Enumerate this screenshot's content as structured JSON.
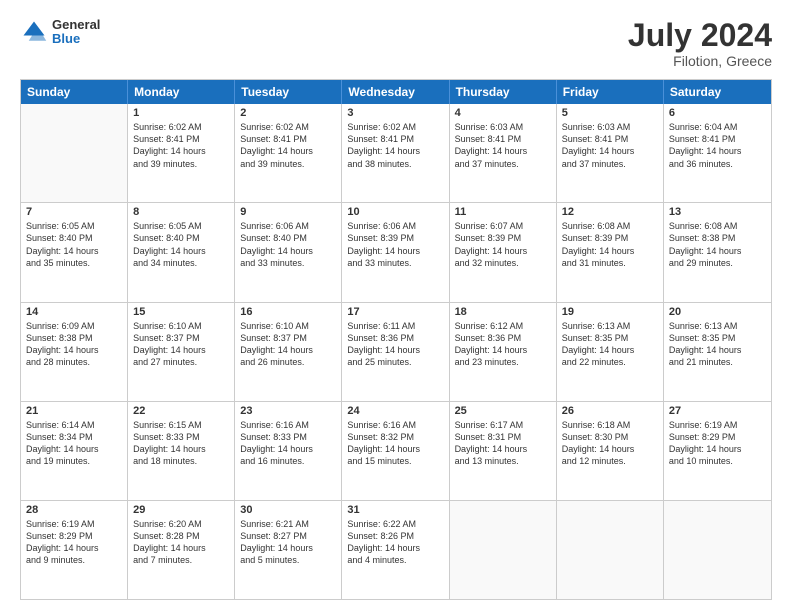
{
  "header": {
    "logo": {
      "general": "General",
      "blue": "Blue"
    },
    "title": "July 2024",
    "location": "Filotion, Greece"
  },
  "weekdays": [
    "Sunday",
    "Monday",
    "Tuesday",
    "Wednesday",
    "Thursday",
    "Friday",
    "Saturday"
  ],
  "weeks": [
    [
      {
        "day": "",
        "info": ""
      },
      {
        "day": "1",
        "info": "Sunrise: 6:02 AM\nSunset: 8:41 PM\nDaylight: 14 hours\nand 39 minutes."
      },
      {
        "day": "2",
        "info": "Sunrise: 6:02 AM\nSunset: 8:41 PM\nDaylight: 14 hours\nand 39 minutes."
      },
      {
        "day": "3",
        "info": "Sunrise: 6:02 AM\nSunset: 8:41 PM\nDaylight: 14 hours\nand 38 minutes."
      },
      {
        "day": "4",
        "info": "Sunrise: 6:03 AM\nSunset: 8:41 PM\nDaylight: 14 hours\nand 37 minutes."
      },
      {
        "day": "5",
        "info": "Sunrise: 6:03 AM\nSunset: 8:41 PM\nDaylight: 14 hours\nand 37 minutes."
      },
      {
        "day": "6",
        "info": "Sunrise: 6:04 AM\nSunset: 8:41 PM\nDaylight: 14 hours\nand 36 minutes."
      }
    ],
    [
      {
        "day": "7",
        "info": "Sunrise: 6:05 AM\nSunset: 8:40 PM\nDaylight: 14 hours\nand 35 minutes."
      },
      {
        "day": "8",
        "info": "Sunrise: 6:05 AM\nSunset: 8:40 PM\nDaylight: 14 hours\nand 34 minutes."
      },
      {
        "day": "9",
        "info": "Sunrise: 6:06 AM\nSunset: 8:40 PM\nDaylight: 14 hours\nand 33 minutes."
      },
      {
        "day": "10",
        "info": "Sunrise: 6:06 AM\nSunset: 8:39 PM\nDaylight: 14 hours\nand 33 minutes."
      },
      {
        "day": "11",
        "info": "Sunrise: 6:07 AM\nSunset: 8:39 PM\nDaylight: 14 hours\nand 32 minutes."
      },
      {
        "day": "12",
        "info": "Sunrise: 6:08 AM\nSunset: 8:39 PM\nDaylight: 14 hours\nand 31 minutes."
      },
      {
        "day": "13",
        "info": "Sunrise: 6:08 AM\nSunset: 8:38 PM\nDaylight: 14 hours\nand 29 minutes."
      }
    ],
    [
      {
        "day": "14",
        "info": "Sunrise: 6:09 AM\nSunset: 8:38 PM\nDaylight: 14 hours\nand 28 minutes."
      },
      {
        "day": "15",
        "info": "Sunrise: 6:10 AM\nSunset: 8:37 PM\nDaylight: 14 hours\nand 27 minutes."
      },
      {
        "day": "16",
        "info": "Sunrise: 6:10 AM\nSunset: 8:37 PM\nDaylight: 14 hours\nand 26 minutes."
      },
      {
        "day": "17",
        "info": "Sunrise: 6:11 AM\nSunset: 8:36 PM\nDaylight: 14 hours\nand 25 minutes."
      },
      {
        "day": "18",
        "info": "Sunrise: 6:12 AM\nSunset: 8:36 PM\nDaylight: 14 hours\nand 23 minutes."
      },
      {
        "day": "19",
        "info": "Sunrise: 6:13 AM\nSunset: 8:35 PM\nDaylight: 14 hours\nand 22 minutes."
      },
      {
        "day": "20",
        "info": "Sunrise: 6:13 AM\nSunset: 8:35 PM\nDaylight: 14 hours\nand 21 minutes."
      }
    ],
    [
      {
        "day": "21",
        "info": "Sunrise: 6:14 AM\nSunset: 8:34 PM\nDaylight: 14 hours\nand 19 minutes."
      },
      {
        "day": "22",
        "info": "Sunrise: 6:15 AM\nSunset: 8:33 PM\nDaylight: 14 hours\nand 18 minutes."
      },
      {
        "day": "23",
        "info": "Sunrise: 6:16 AM\nSunset: 8:33 PM\nDaylight: 14 hours\nand 16 minutes."
      },
      {
        "day": "24",
        "info": "Sunrise: 6:16 AM\nSunset: 8:32 PM\nDaylight: 14 hours\nand 15 minutes."
      },
      {
        "day": "25",
        "info": "Sunrise: 6:17 AM\nSunset: 8:31 PM\nDaylight: 14 hours\nand 13 minutes."
      },
      {
        "day": "26",
        "info": "Sunrise: 6:18 AM\nSunset: 8:30 PM\nDaylight: 14 hours\nand 12 minutes."
      },
      {
        "day": "27",
        "info": "Sunrise: 6:19 AM\nSunset: 8:29 PM\nDaylight: 14 hours\nand 10 minutes."
      }
    ],
    [
      {
        "day": "28",
        "info": "Sunrise: 6:19 AM\nSunset: 8:29 PM\nDaylight: 14 hours\nand 9 minutes."
      },
      {
        "day": "29",
        "info": "Sunrise: 6:20 AM\nSunset: 8:28 PM\nDaylight: 14 hours\nand 7 minutes."
      },
      {
        "day": "30",
        "info": "Sunrise: 6:21 AM\nSunset: 8:27 PM\nDaylight: 14 hours\nand 5 minutes."
      },
      {
        "day": "31",
        "info": "Sunrise: 6:22 AM\nSunset: 8:26 PM\nDaylight: 14 hours\nand 4 minutes."
      },
      {
        "day": "",
        "info": ""
      },
      {
        "day": "",
        "info": ""
      },
      {
        "day": "",
        "info": ""
      }
    ]
  ]
}
